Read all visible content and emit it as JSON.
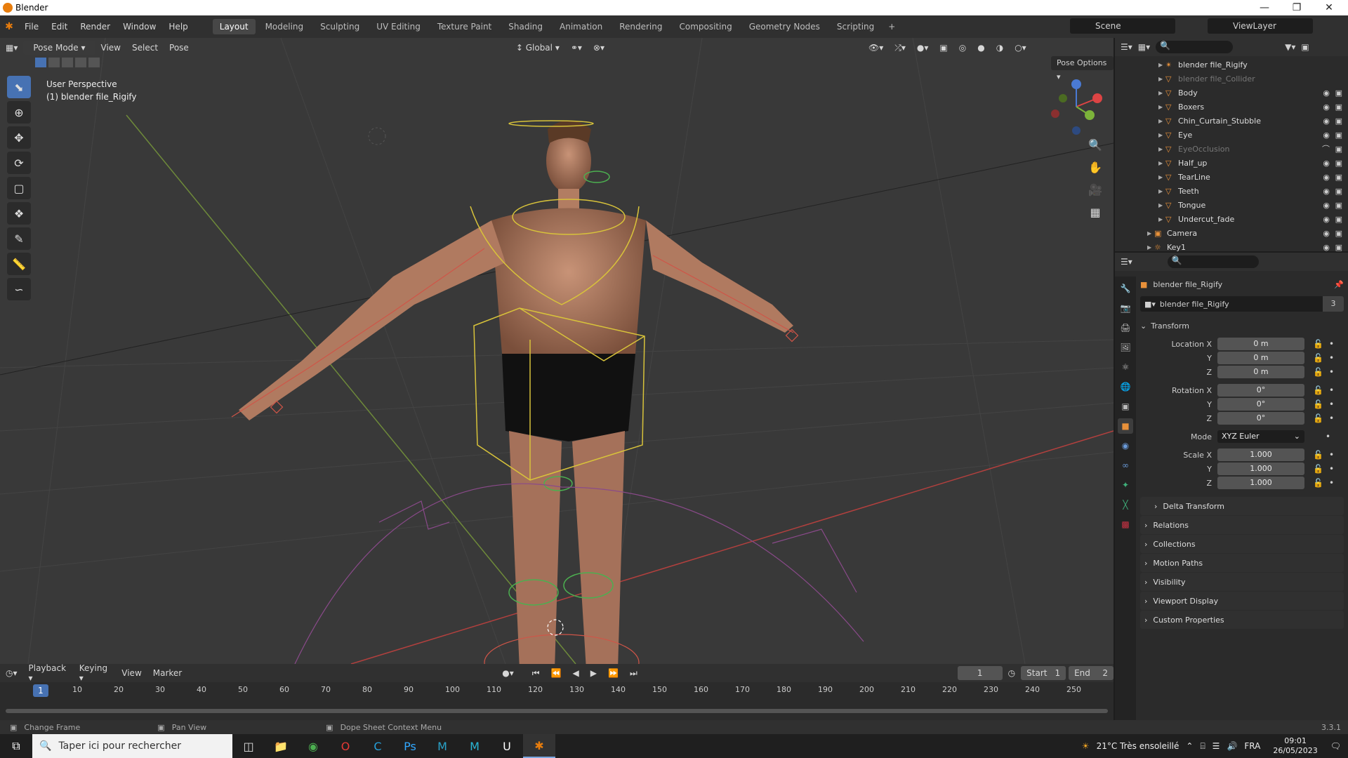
{
  "window": {
    "title": "Blender"
  },
  "menu": [
    "File",
    "Edit",
    "Render",
    "Window",
    "Help"
  ],
  "workspaces": [
    "Layout",
    "Modeling",
    "Sculpting",
    "UV Editing",
    "Texture Paint",
    "Shading",
    "Animation",
    "Rendering",
    "Compositing",
    "Geometry Nodes",
    "Scripting"
  ],
  "active_workspace": "Layout",
  "scene": {
    "name": "Scene",
    "view_layer": "ViewLayer"
  },
  "viewport": {
    "mode": "Pose Mode",
    "menus": [
      "View",
      "Select",
      "Pose"
    ],
    "transform_orientation": "Global",
    "perspective_label": "User Perspective",
    "object_label": "(1) blender file_Rigify",
    "pose_options": "Pose Options"
  },
  "outliner": {
    "items": [
      {
        "label": "blender file_Rigify",
        "dim": false
      },
      {
        "label": "blender file_Collider",
        "dim": true
      },
      {
        "label": "Body",
        "dim": false
      },
      {
        "label": "Boxers",
        "dim": false
      },
      {
        "label": "Chin_Curtain_Stubble",
        "dim": false
      },
      {
        "label": "Eye",
        "dim": false
      },
      {
        "label": "EyeOcclusion",
        "dim": true
      },
      {
        "label": "Half_up",
        "dim": false
      },
      {
        "label": "TearLine",
        "dim": false
      },
      {
        "label": "Teeth",
        "dim": false
      },
      {
        "label": "Tongue",
        "dim": false
      },
      {
        "label": "Undercut_fade",
        "dim": false
      },
      {
        "label": "Camera",
        "dim": false
      },
      {
        "label": "Key1",
        "dim": false
      }
    ]
  },
  "properties": {
    "object_name": "blender file_Rigify",
    "data_name": "blender file_Rigify",
    "users": "3",
    "transform_label": "Transform",
    "location": {
      "label": "Location X",
      "x": "0 m",
      "y": "0 m",
      "z": "0 m"
    },
    "rotation": {
      "label": "Rotation X",
      "x": "0°",
      "y": "0°",
      "z": "0°"
    },
    "mode_label": "Mode",
    "mode_value": "XYZ Euler",
    "scale": {
      "label": "Scale X",
      "x": "1.000",
      "y": "1.000",
      "z": "1.000"
    },
    "axis_y": "Y",
    "axis_z": "Z",
    "panels": [
      "Delta Transform",
      "Relations",
      "Collections",
      "Motion Paths",
      "Visibility",
      "Viewport Display",
      "Custom Properties"
    ]
  },
  "timeline": {
    "menus": [
      "Playback",
      "Keying",
      "View",
      "Marker"
    ],
    "current_frame": "1",
    "start_label": "Start",
    "start": "1",
    "end_label": "End",
    "end": "2",
    "ticks": [
      "10",
      "20",
      "30",
      "40",
      "50",
      "60",
      "70",
      "80",
      "90",
      "100",
      "110",
      "120",
      "130",
      "140",
      "150",
      "160",
      "170",
      "180",
      "190",
      "200",
      "210",
      "220",
      "230",
      "240",
      "250"
    ]
  },
  "statusbar": {
    "items": [
      "Change Frame",
      "Pan View",
      "Dope Sheet Context Menu"
    ],
    "version": "3.3.1"
  },
  "taskbar": {
    "search_placeholder": "Taper ici pour rechercher",
    "weather": "21°C  Très ensoleillé",
    "lang": "FRA",
    "time": "09:01",
    "date": "26/05/2023"
  }
}
